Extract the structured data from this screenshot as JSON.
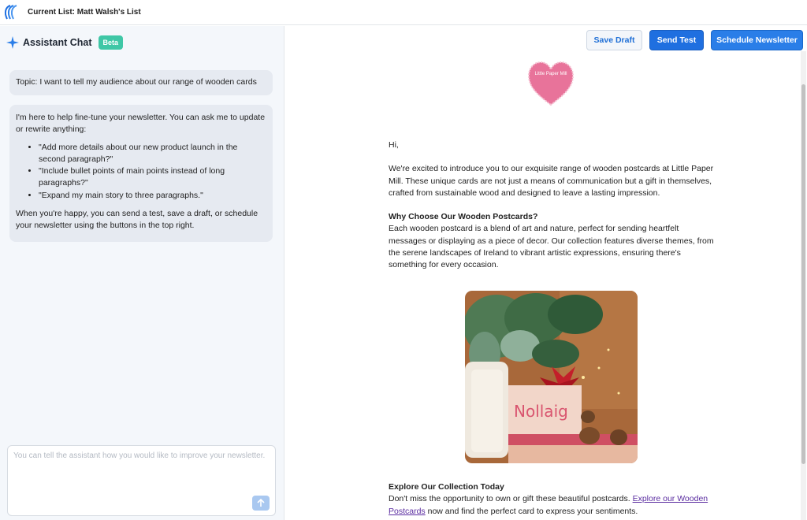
{
  "header": {
    "current_list": "Current List: Matt Walsh's List"
  },
  "assistant": {
    "title": "Assistant Chat",
    "badge": "Beta",
    "messages": {
      "topic": "Topic: I want to tell my audience about our range of wooden cards",
      "intro": "I'm here to help fine-tune your newsletter. You can ask me to update or rewrite anything:",
      "suggestions": [
        "\"Add more details about our new product launch in the second paragraph?\"",
        "\"Include bullet points of main points instead of long paragraphs?\"",
        "\"Expand my main story to three paragraphs.\""
      ],
      "outro": "When you're happy, you can send a test, save a draft, or schedule your newsletter using the buttons in the top right."
    },
    "composer": {
      "placeholder": "You can tell the assistant how you would like to improve your newsletter.",
      "value": ""
    }
  },
  "toolbar": {
    "save_draft": "Save Draft",
    "send_test": "Send Test",
    "schedule": "Schedule Newsletter"
  },
  "email": {
    "brand": "Little Paper Mill",
    "greeting": "Hi,",
    "intro": "We're excited to introduce you to our exquisite range of wooden postcards at Little Paper Mill. These unique cards are not just a means of communication but a gift in themselves, crafted from sustainable wood and designed to leave a lasting impression.",
    "section1_heading": "Why Choose Our Wooden Postcards?",
    "section1_body": "Each wooden postcard is a blend of art and nature, perfect for sending heartfelt messages or displaying as a piece of decor. Our collection features diverse themes, from the serene landscapes of Ireland to vibrant artistic expressions, ensuring there's something for every occasion.",
    "image_card_text": "Nollaig",
    "section2_heading": "Explore Our Collection Today",
    "section2_pre": "Don't miss the opportunity to own or gift these beautiful postcards. ",
    "section2_link": "Explore our Wooden Postcards",
    "section2_post": " now and find the perfect card to express your sentiments."
  },
  "colors": {
    "accent_blue": "#1f6fe0",
    "beta_badge": "#3fc7a6",
    "brand_pink": "#e8739a"
  },
  "icons": {
    "logo": "brand-logo-icon",
    "assistant": "sparkle-icon",
    "send": "arrow-up-icon"
  }
}
